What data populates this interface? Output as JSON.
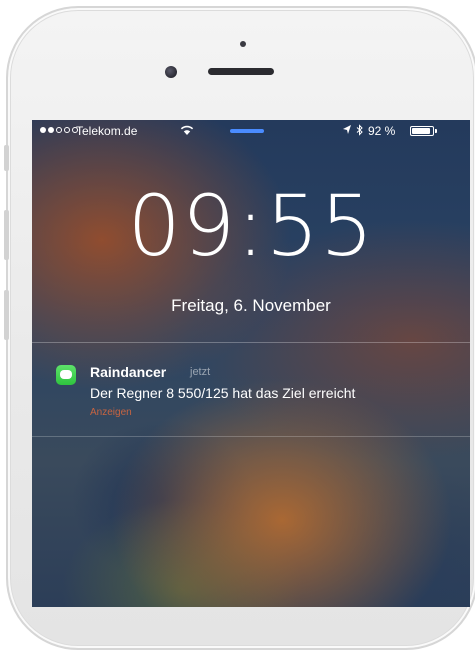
{
  "status_bar": {
    "carrier": "Telekom.de",
    "battery_percent": "92 %",
    "battery_level": 0.92,
    "signal_strength": 2,
    "signal_max": 5,
    "icons": [
      "wifi-icon",
      "location-icon",
      "bluetooth-icon",
      "battery-icon"
    ],
    "now_playing_color": "#4a8cff"
  },
  "lock_screen": {
    "time": "09:55",
    "date": "Freitag, 6. November"
  },
  "notification": {
    "app_name": "Raindancer",
    "time": "jetzt",
    "message": "Der Regner 8 550/125 hat das Ziel erreicht",
    "action_hint": "Anzeigen",
    "app_icon": "messages-icon",
    "app_icon_color": "#3ad24a",
    "action_color": "#e0693c"
  }
}
